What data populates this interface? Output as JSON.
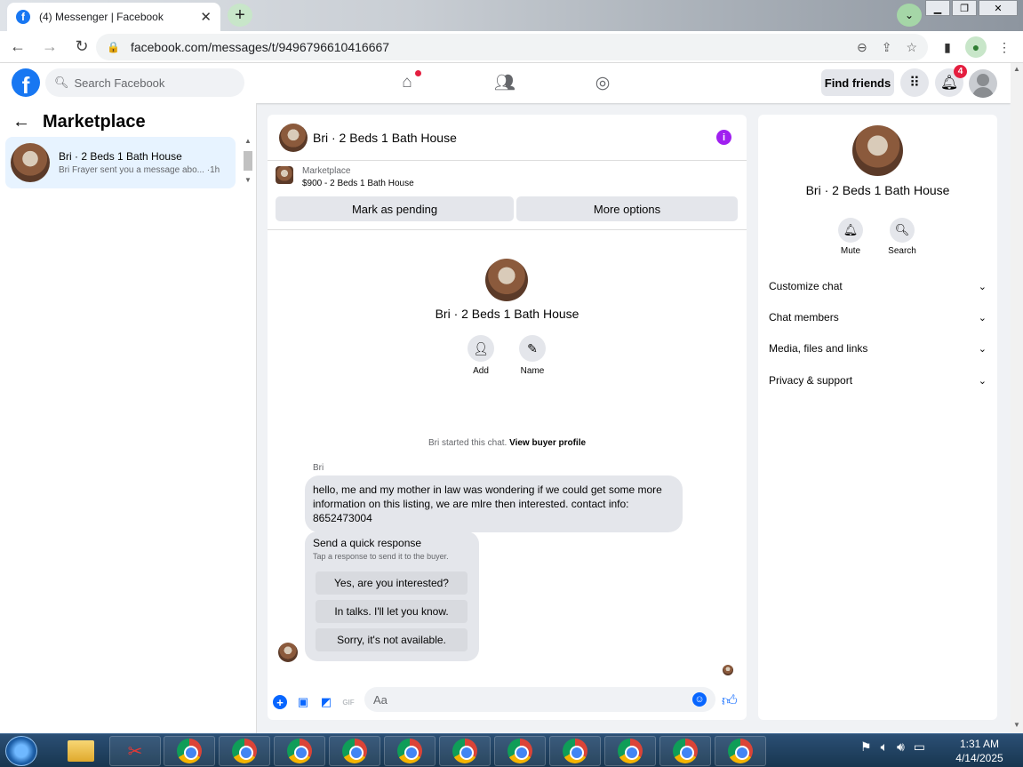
{
  "browser": {
    "tab_title": "(4) Messenger | Facebook",
    "tab_close": "✕",
    "new_tab": "+",
    "url": "facebook.com/messages/t/9496796610416667"
  },
  "facebook": {
    "logo": "f",
    "search_placeholder": "Search Facebook",
    "find_friends": "Find friends",
    "notification_count": "4"
  },
  "left_pane": {
    "title": "Marketplace",
    "threads": [
      {
        "name": "Bri · 2 Beds 1 Bath House",
        "snippet": "Bri Frayer sent you a message abo... ·1h"
      }
    ]
  },
  "chat": {
    "header_title": "Bri · 2 Beds 1 Bath House",
    "marketplace_label": "Marketplace",
    "listing": "$900 - 2 Beds 1 Bath House",
    "mark_pending": "Mark as pending",
    "more_options": "More options",
    "profile_name": "Bri · 2 Beds 1 Bath House",
    "actions": [
      {
        "label": "Add",
        "icon": "add-person-icon"
      },
      {
        "label": "Name",
        "icon": "pencil-icon"
      }
    ],
    "started_text": "Bri started this chat.",
    "view_buyer": "View buyer profile",
    "sender": "Bri",
    "message": "hello, me and my mother in law was wondering if we could get some more information on this listing, we are mlre then interested. contact info: 8652473004",
    "quick_response": {
      "title": "Send a quick response",
      "subtitle": "Tap a response to send it to the buyer.",
      "options": [
        "Yes, are you interested?",
        "In talks. I'll let you know.",
        "Sorry, it's not available."
      ]
    },
    "composer_placeholder": "Aa"
  },
  "right_pane": {
    "name": "Bri · 2 Beds 1 Bath House",
    "actions": [
      {
        "label": "Mute",
        "icon": "bell-icon"
      },
      {
        "label": "Search",
        "icon": "search-icon"
      }
    ],
    "sections": [
      "Customize chat",
      "Chat members",
      "Media, files and links",
      "Privacy & support"
    ]
  },
  "taskbar": {
    "time": "1:31 AM",
    "date": "4/14/2025"
  },
  "colors": {
    "facebook_blue": "#1877f2",
    "messenger_blue": "#0866ff",
    "selected_thread": "#e7f3ff",
    "badge_red": "#e41e3f",
    "info_purple": "#a020f0"
  }
}
